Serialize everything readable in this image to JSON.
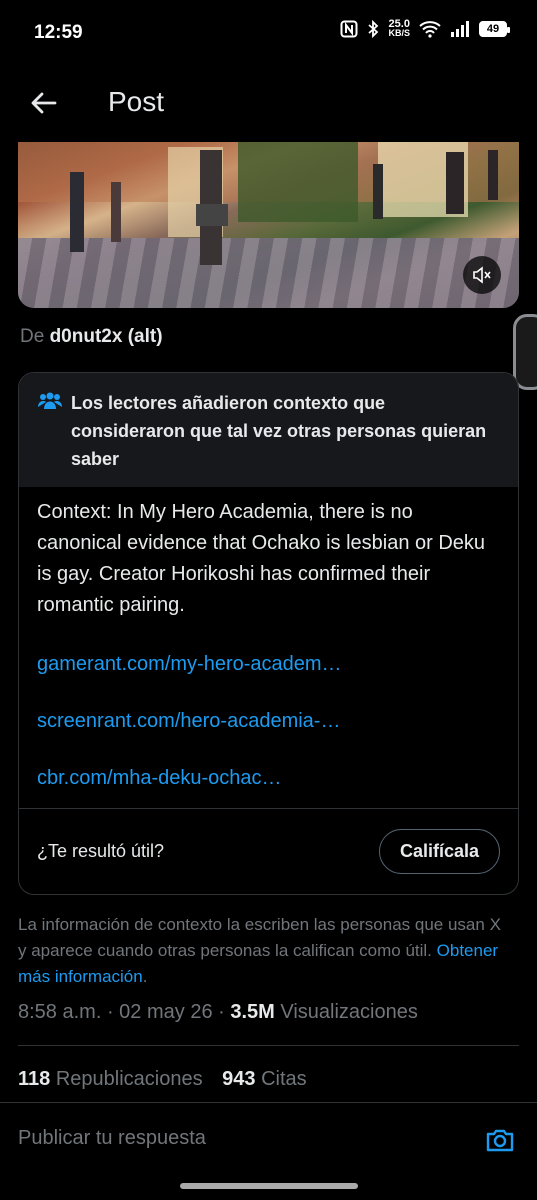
{
  "status_bar": {
    "time": "12:59",
    "net_speed_value": "25.0",
    "net_speed_unit": "KB/S",
    "battery": "49"
  },
  "header": {
    "title": "Post"
  },
  "media": {
    "attribution_prefix": "De",
    "attribution_name": "d0nut2x (alt)"
  },
  "note": {
    "title": "Los lectores añadieron contexto que consideraron que tal vez otras personas quieran saber",
    "text": "Context: In My Hero Academia, there is no canonical evidence that Ochako is lesbian or Deku is gay. Creator Horikoshi has confirmed their romantic pairing.",
    "links": [
      "gamerant.com/my-hero-academ…",
      "screenrant.com/hero-academia-…",
      "cbr.com/mha-deku-ochac…"
    ],
    "footer_question": "¿Te resultó útil?",
    "rate_button": "Califícala"
  },
  "disclaimer": {
    "text": "La información de contexto la escriben las personas que usan X y aparece cuando otras personas la califican como útil.",
    "link": "Obtener más información"
  },
  "meta": {
    "time": "8:58 a.m.",
    "date": "02 may 26",
    "views_count": "3.5M",
    "views_label": "Visualizaciones"
  },
  "stats": {
    "reposts_count": "118",
    "reposts_label": "Republicaciones",
    "quotes_count": "943",
    "quotes_label": "Citas"
  },
  "reply": {
    "placeholder": "Publicar tu respuesta"
  },
  "colors": {
    "background": "#000000",
    "link": "#1d9bf0",
    "muted": "#71767b",
    "text": "#e7e9ea",
    "border": "#2f3336"
  }
}
